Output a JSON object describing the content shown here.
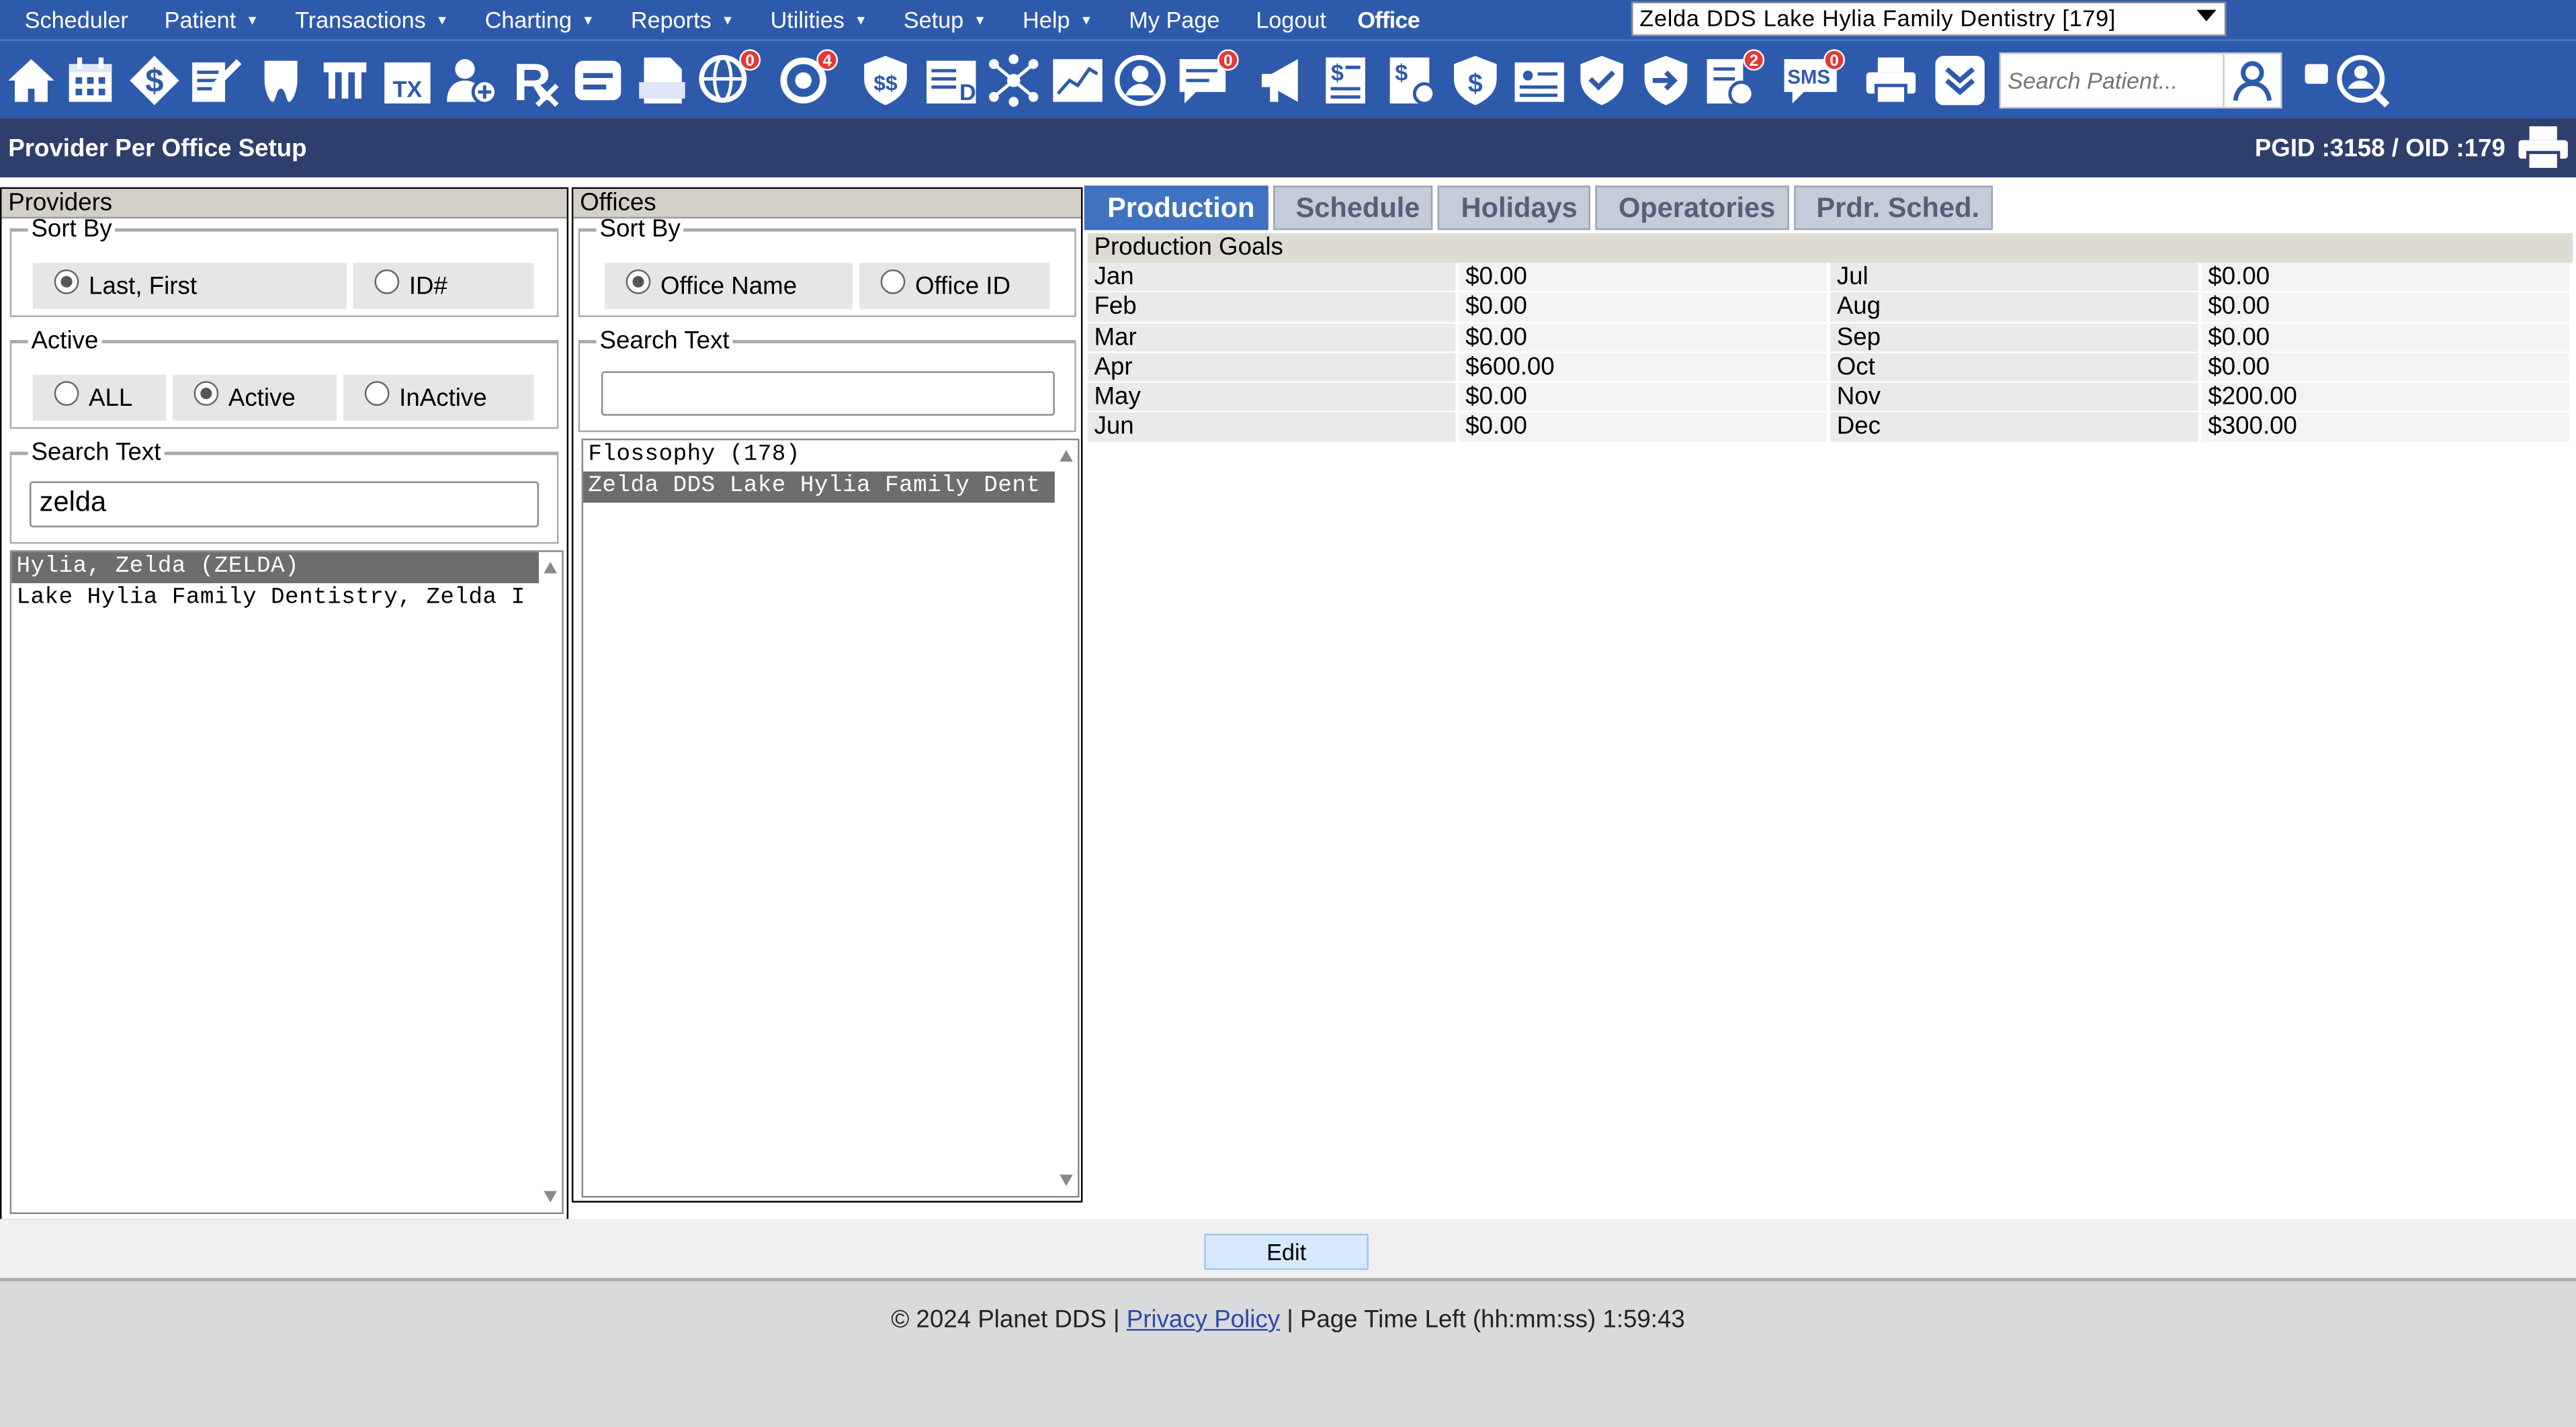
{
  "menu": {
    "items": [
      {
        "label": "Scheduler",
        "caret": false
      },
      {
        "label": "Patient",
        "caret": true
      },
      {
        "label": "Transactions",
        "caret": true
      },
      {
        "label": "Charting",
        "caret": true
      },
      {
        "label": "Reports",
        "caret": true
      },
      {
        "label": "Utilities",
        "caret": true
      },
      {
        "label": "Setup",
        "caret": true
      },
      {
        "label": "Help",
        "caret": true
      },
      {
        "label": "My Page",
        "caret": false
      },
      {
        "label": "Logout",
        "caret": false
      }
    ],
    "office_label": "Office",
    "office_value": "Zelda DDS Lake Hylia Family Dentistry [179]"
  },
  "toolbar": {
    "icons": [
      "home-icon",
      "calendar-icon",
      "dollar-icon",
      "edit-chart-icon",
      "tooth-icon",
      "teeth-icon",
      "treatment-calendar-icon",
      "add-user-icon",
      "prescription-icon",
      "notes-icon",
      "document-icon",
      "globe-icon",
      "sync-icon",
      "insurance-icon",
      "ledger-icon",
      "network-icon",
      "chart-icon",
      "web-icon",
      "messages-icon",
      "megaphone-icon",
      "statement-icon",
      "billing-settings-icon",
      "shield-dollar-icon",
      "id-card-icon",
      "shield-check-icon",
      "shield-arrow-icon",
      "checklist-icon",
      "sms-icon",
      "printer-icon",
      "download-icon"
    ],
    "badges": {
      "globe": "0",
      "sync": "4",
      "messages": "0",
      "checklist": "2",
      "sms": "0"
    },
    "sms_text": "SMS",
    "search_placeholder": "Search Patient..."
  },
  "title": {
    "page_title": "Provider Per Office Setup",
    "pgid": "PGID :3158  /  OID :179"
  },
  "providers": {
    "header": "Providers",
    "sort_by_legend": "Sort By",
    "sort_options": [
      "Last, First",
      "ID#"
    ],
    "sort_selected": 0,
    "active_legend": "Active",
    "active_options": [
      "ALL",
      "Active",
      "InActive"
    ],
    "active_selected": 1,
    "search_legend": "Search Text",
    "search_value": "zelda",
    "list": [
      {
        "text": "Hylia, Zelda (ZELDA)",
        "selected": true
      },
      {
        "text": "Lake Hylia Family Dentistry, Zelda I",
        "selected": false
      }
    ]
  },
  "offices": {
    "header": "Offices",
    "sort_by_legend": "Sort By",
    "sort_options": [
      "Office Name",
      "Office ID"
    ],
    "sort_selected": 0,
    "search_legend": "Search Text",
    "search_value": "",
    "list": [
      {
        "text": "Flossophy (178)",
        "selected": false
      },
      {
        "text": "Zelda DDS Lake Hylia Family Dent",
        "selected": true
      }
    ]
  },
  "tabs": [
    {
      "label": "Production",
      "active": true
    },
    {
      "label": "Schedule",
      "active": false
    },
    {
      "label": "Holidays",
      "active": false
    },
    {
      "label": "Operatories",
      "active": false
    },
    {
      "label": "Prdr. Sched.",
      "active": false
    }
  ],
  "production_goals": {
    "header": "Production Goals",
    "rows": [
      {
        "m1": "Jan",
        "v1": "$0.00",
        "m2": "Jul",
        "v2": "$0.00"
      },
      {
        "m1": "Feb",
        "v1": "$0.00",
        "m2": "Aug",
        "v2": "$0.00"
      },
      {
        "m1": "Mar",
        "v1": "$0.00",
        "m2": "Sep",
        "v2": "$0.00"
      },
      {
        "m1": "Apr",
        "v1": "$600.00",
        "m2": "Oct",
        "v2": "$0.00"
      },
      {
        "m1": "May",
        "v1": "$0.00",
        "m2": "Nov",
        "v2": "$200.00"
      },
      {
        "m1": "Jun",
        "v1": "$0.00",
        "m2": "Dec",
        "v2": "$300.00"
      }
    ]
  },
  "actions": {
    "edit_label": "Edit"
  },
  "footer": {
    "copyright": "© 2024 Planet DDS | ",
    "privacy": "Privacy Policy",
    "time_left": " |  Page Time Left (hh:mm:ss) 1:59:43"
  },
  "colors": {
    "nav_blue": "#2e5aac",
    "title_bar": "#2f3f6c",
    "tab_active": "#3f72c1",
    "badge_red": "#e53935"
  }
}
